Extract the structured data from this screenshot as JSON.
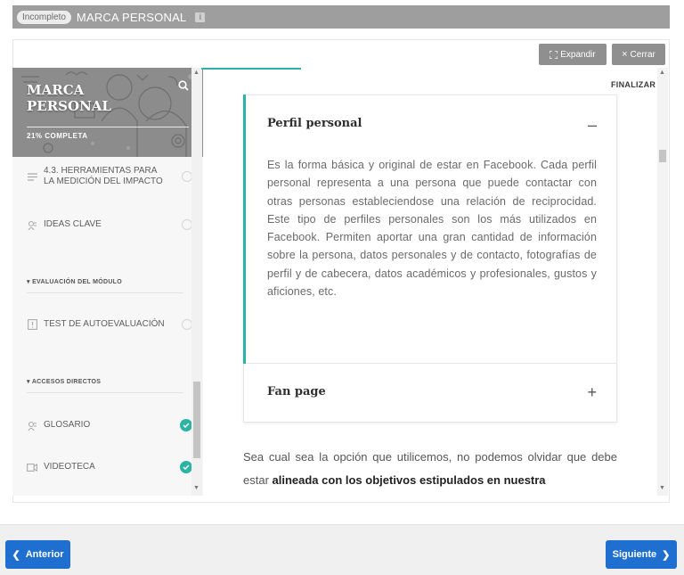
{
  "header": {
    "status_badge": "Incompleto",
    "course_title": "MARCA PERSONAL",
    "info_icon": "i"
  },
  "toolbar": {
    "expand_label": "Expandir",
    "close_label": "Cerrar"
  },
  "sidebar": {
    "hero_title_line1": "MARCA",
    "hero_title_line2": "PERSONAL",
    "progress_label": "21% COMPLETA",
    "items": [
      {
        "label_line1": "4.3. HERRAMIENTAS PARA",
        "label_line2": "LA MEDICIÓN DEL IMPACTO",
        "icon": "list-icon",
        "status": "incomplete"
      },
      {
        "label": "IDEAS CLAVE",
        "icon": "key-ideas-icon",
        "status": "incomplete"
      },
      {
        "label": "TEST DE AUTOEVALUACIÓN",
        "icon": "test-icon",
        "status": "incomplete"
      },
      {
        "label": "GLOSARIO",
        "icon": "glossary-icon",
        "status": "complete"
      },
      {
        "label": "VIDEOTECA",
        "icon": "video-icon",
        "status": "complete"
      }
    ],
    "section_evaluation": "EVALUACIÓN DEL MÓDULO",
    "section_shortcuts": "ACCESOS DIRECTOS"
  },
  "content": {
    "finalize_label": "FINALIZAR",
    "accordion": [
      {
        "title": "Perfil personal",
        "toggle": "–",
        "body": "Es la forma básica y original de estar en Facebook. Cada perfil personal representa a una persona que puede contactar con otras personas estableciendose una relación de reciprocidad. Este tipo de perfiles personales son los más utilizados en Facebook. Permiten aportar una gran cantidad de información sobre la persona, datos personales y de contacto, fotografías de perfil y de cabecera, datos académicos y profesionales, gustos y aficiones, etc."
      },
      {
        "title": "Fan page",
        "toggle": "+"
      }
    ],
    "paragraph_start": "Sea cual sea la opción que utilicemos, no podemos olvidar que debe estar ",
    "paragraph_bold": "alineada con los objetivos estipulados en nuestra"
  },
  "footer": {
    "prev_label": "Anterior",
    "next_label": "Siguiente"
  },
  "colors": {
    "accent": "#2bb3a5",
    "primary_button": "#1f6fd1",
    "header_bar": "#9e9e9e"
  }
}
